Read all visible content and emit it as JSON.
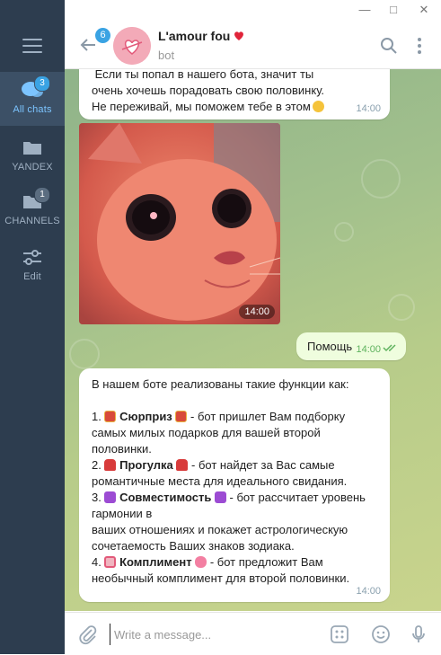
{
  "sidebar": {
    "items": [
      {
        "label": "All chats",
        "badge": "3"
      },
      {
        "label": "YANDEX"
      },
      {
        "label": "CHANNELS",
        "badge": "1"
      },
      {
        "label": "Edit"
      }
    ]
  },
  "header": {
    "back_badge": "6",
    "title": "L'amour fou",
    "subtitle": "bot"
  },
  "messages": {
    "m1_text": " Если ты попал в нашего бота, значит ты очень хочешь порадовать свою половинку. Не переживай, мы поможем тебе в этом",
    "m1_time": "14:00",
    "photo_time": "14:00",
    "out_text": "Помощь",
    "out_time": "14:00",
    "m3": {
      "intro": "В нашем боте реализованы такие функции как:",
      "f1_num": "1. ",
      "f1_name": "Сюрприз",
      "f1_desc": " - бот пришлет Вам подборку самых милых подарков для вашей второй половинки.",
      "f2_num": "2. ",
      "f2_name": "Прогулка",
      "f2_desc": " - бот найдет за Вас самые романтичные места для идеального свидания.",
      "f3_num": "3. ",
      "f3_name": "Совместимость",
      "f3_desc": " - бот рассчитает уровень гармонии в",
      "f3_desc2": "ваших отношениях и покажет астрологическую сочетаемость Ваших знаков зодиака.",
      "f4_num": "4. ",
      "f4_name": "Комплимент",
      "f4_desc": " - бот предложит Вам необычный комплимент для второй половинки.",
      "time": "14:00"
    }
  },
  "composer": {
    "placeholder": "Write a message..."
  },
  "colors": {
    "accent": "#3aa3e3",
    "sidebar": "#2d3d4f",
    "out_bubble": "#effdde"
  }
}
